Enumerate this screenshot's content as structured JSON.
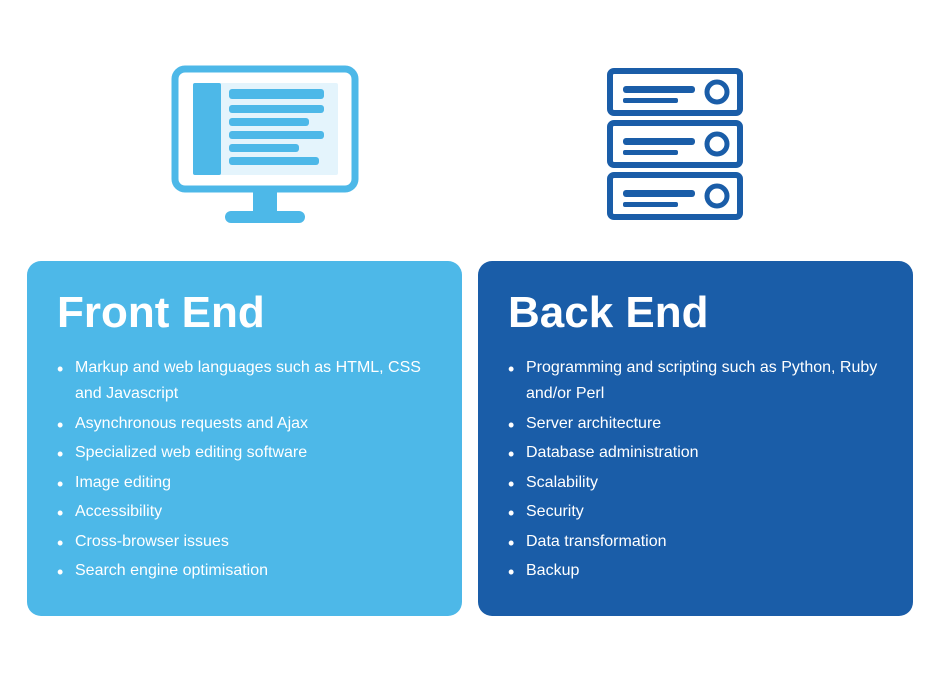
{
  "icons": {
    "monitor_alt": "Monitor icon representing front end",
    "server_alt": "Server icon representing back end"
  },
  "frontend": {
    "title": "Front End",
    "items": [
      "Markup and web languages such as HTML, CSS and Javascript",
      "Asynchronous requests and Ajax",
      "Specialized web editing software",
      "Image editing",
      "Accessibility",
      "Cross-browser issues",
      "Search engine optimisation"
    ]
  },
  "backend": {
    "title": "Back End",
    "items": [
      "Programming and scripting such as Python, Ruby and/or Perl",
      "Server architecture",
      "Database administration",
      "Scalability",
      "Security",
      "Data transformation",
      "Backup"
    ]
  }
}
